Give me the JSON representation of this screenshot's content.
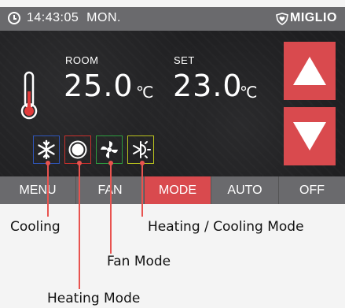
{
  "status_bar": {
    "time": "14:43:05",
    "day": "MON.",
    "brand": "MIGLIO",
    "clock_icon": "clock-icon",
    "brand_icon": "shield-heart-icon"
  },
  "readings": {
    "room_label": "ROOM",
    "room_value": "25.0",
    "set_label": "SET",
    "set_value": "23.0",
    "unit": "℃"
  },
  "mode_icons": [
    {
      "name": "snowflake-icon",
      "color": "#2f55b8"
    },
    {
      "name": "sun-icon",
      "color": "#c9302c"
    },
    {
      "name": "fan-icon",
      "color": "#2e9d3f"
    },
    {
      "name": "heat-cool-icon",
      "color": "#b9c21e"
    }
  ],
  "bottom_bar": {
    "menu": "MENU",
    "fan": "FAN",
    "mode": "MODE",
    "auto": "AUTO",
    "off": "OFF"
  },
  "annotations": {
    "cooling": "Cooling",
    "heating_cooling_mode": "Heating / Cooling Mode",
    "fan_mode": "Fan Mode",
    "heating_mode": "Heating Mode"
  },
  "colors": {
    "accent": "#d94a4e",
    "bar": "#6a6a6d",
    "screen_bg": "#1f1f21",
    "leader": "#e8534f"
  }
}
